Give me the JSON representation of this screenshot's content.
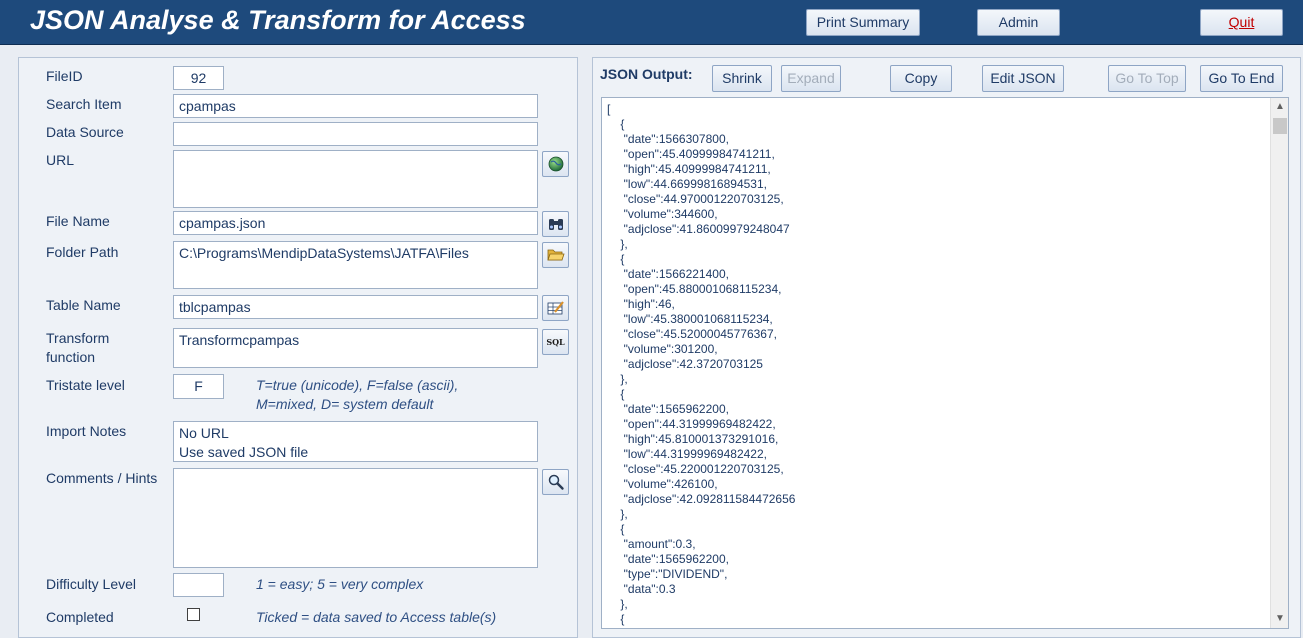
{
  "header": {
    "title": "JSON Analyse & Transform for Access",
    "print_summary": "Print Summary",
    "admin": "Admin",
    "quit": "Quit"
  },
  "form": {
    "file_id_label": "FileID",
    "file_id": "92",
    "search_item_label": "Search Item",
    "search_item": "cpampas",
    "data_source_label": "Data Source",
    "data_source": "",
    "url_label": "URL",
    "url": "",
    "file_name_label": "File Name",
    "file_name": "cpampas.json",
    "folder_path_label": "Folder Path",
    "folder_path": "C:\\Programs\\MendipDataSystems\\JATFA\\Files",
    "table_name_label": "Table Name",
    "table_name": "tblcpampas",
    "transform_label": "Transform\nfunction",
    "transform_function": "Transformcpampas",
    "tristate_label": "Tristate level",
    "tristate": "F",
    "tristate_hint": "T=true (unicode), F=false (ascii),\nM=mixed, D= system default",
    "import_notes_label": "Import Notes",
    "import_notes": "No URL\nUse saved JSON file",
    "comments_label": "Comments / Hints",
    "comments": "",
    "difficulty_label": "Difficulty Level",
    "difficulty": "",
    "difficulty_hint": "1 = easy; 5 = very complex",
    "completed_label": "Completed",
    "completed": false,
    "completed_hint": "Ticked = data saved to Access table(s)"
  },
  "icons": {
    "url_button": "globe-icon",
    "file_button": "binoculars-icon",
    "folder_button": "folder-open-icon",
    "table_button": "table-edit-icon",
    "sql_button": "sql-icon",
    "sql_text": "SQL",
    "comments_button": "magnifier-icon"
  },
  "json_panel": {
    "title": "JSON Output:",
    "shrink": "Shrink",
    "expand": "Expand",
    "copy": "Copy",
    "edit_json": "Edit JSON",
    "go_to_top": "Go To Top",
    "go_to_end": "Go To End",
    "content": "[\n    {\n     \"date\":1566307800,\n     \"open\":45.40999984741211,\n     \"high\":45.40999984741211,\n     \"low\":44.66999816894531,\n     \"close\":44.970001220703125,\n     \"volume\":344600,\n     \"adjclose\":41.86009979248047\n    },\n    {\n     \"date\":1566221400,\n     \"open\":45.880001068115234,\n     \"high\":46,\n     \"low\":45.380001068115234,\n     \"close\":45.52000045776367,\n     \"volume\":301200,\n     \"adjclose\":42.3720703125\n    },\n    {\n     \"date\":1565962200,\n     \"open\":44.31999969482422,\n     \"high\":45.810001373291016,\n     \"low\":44.31999969482422,\n     \"close\":45.220001220703125,\n     \"volume\":426100,\n     \"adjclose\":42.092811584472656\n    },\n    {\n     \"amount\":0.3,\n     \"date\":1565962200,\n     \"type\":\"DIVIDEND\",\n     \"data\":0.3\n    },\n    {"
  },
  "colors": {
    "header_bg": "#1e4a7c",
    "text": "#1f3b66",
    "quit_text": "#c00000"
  }
}
